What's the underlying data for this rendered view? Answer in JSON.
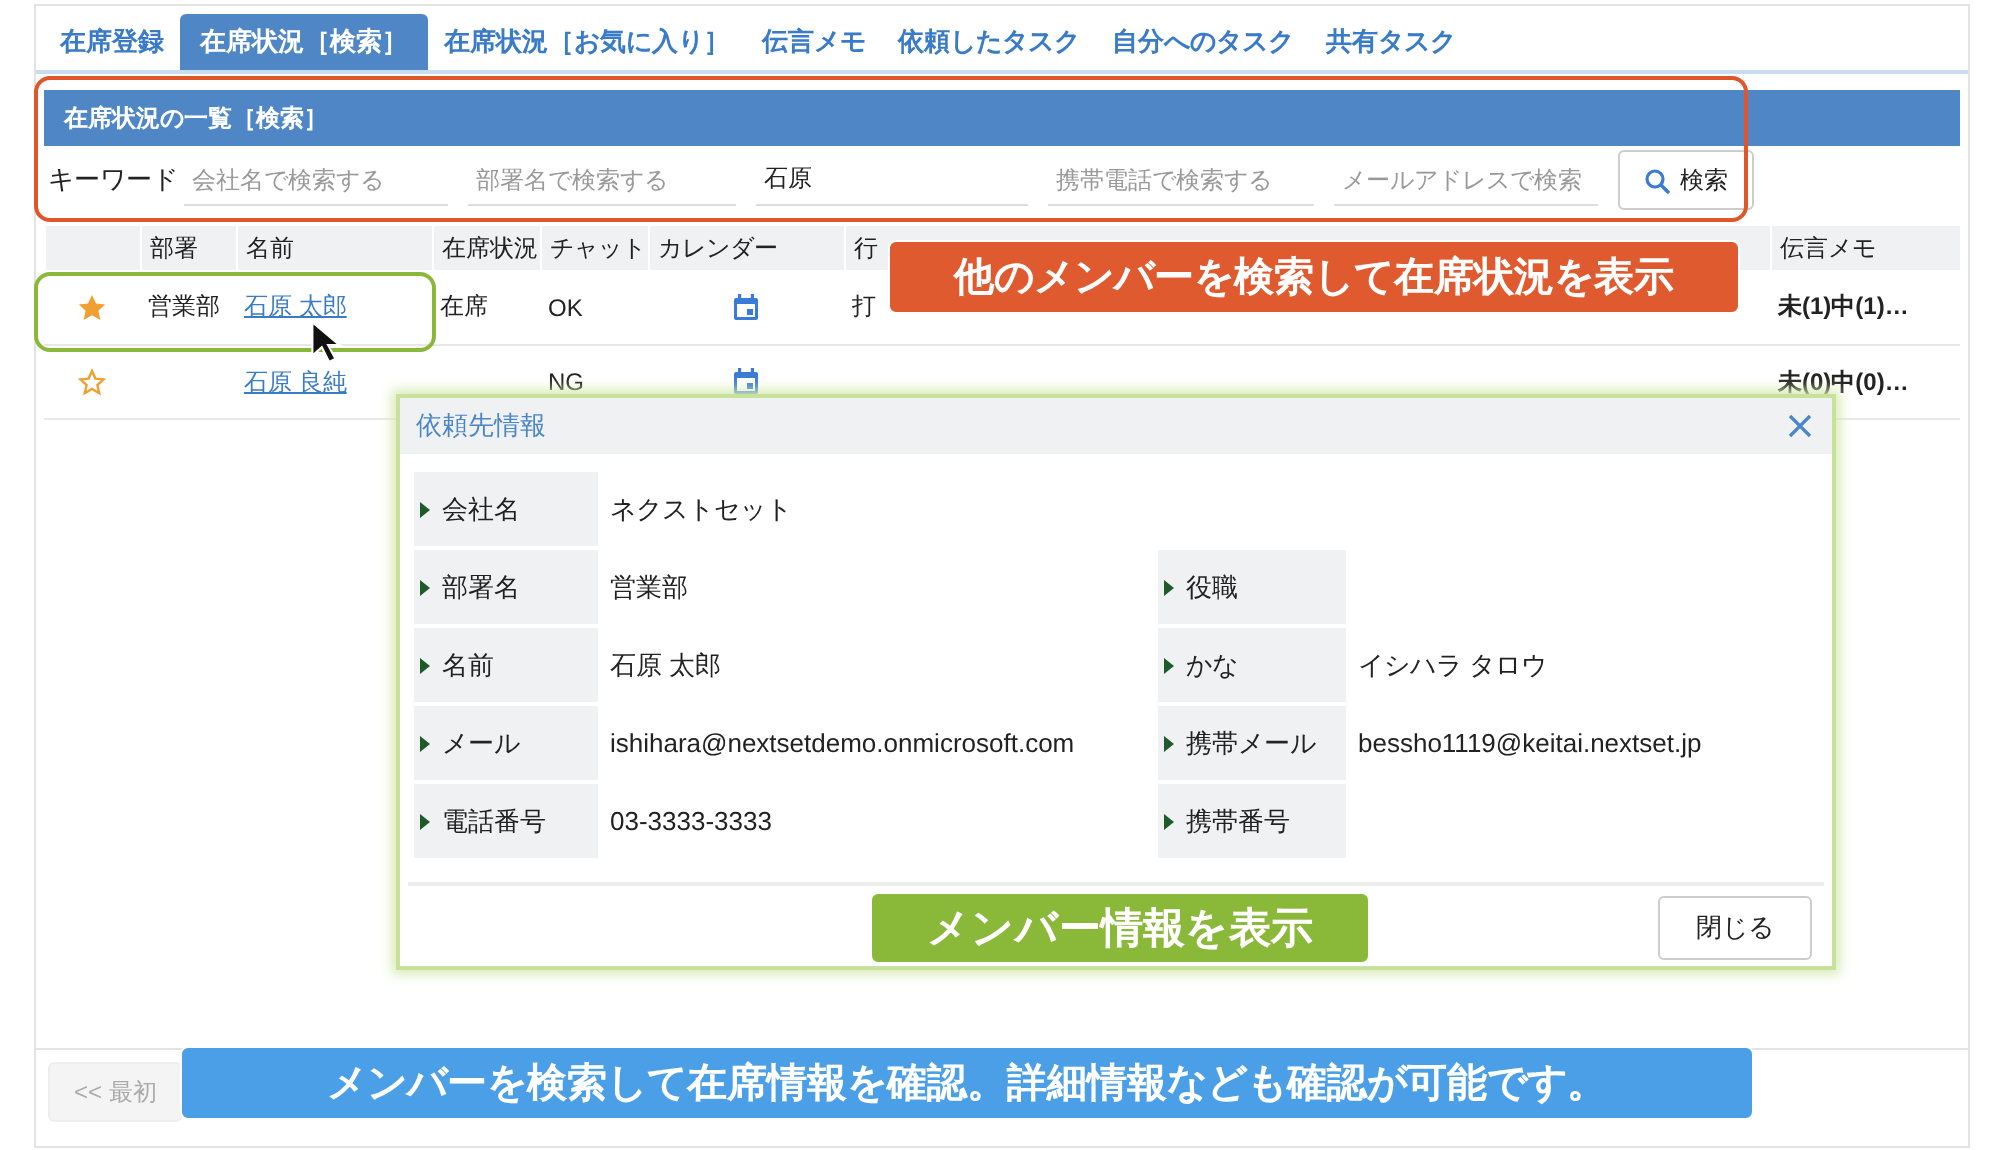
{
  "tabs": [
    {
      "label": "在席登録",
      "selected": false
    },
    {
      "label": "在席状況［検索］",
      "selected": true
    },
    {
      "label": "在席状況［お気に入り］",
      "selected": false
    },
    {
      "label": "伝言メモ",
      "selected": false
    },
    {
      "label": "依頼したタスク",
      "selected": false
    },
    {
      "label": "自分へのタスク",
      "selected": false
    },
    {
      "label": "共有タスク",
      "selected": false
    }
  ],
  "search_panel": {
    "title": "在席状況の一覧［検索］",
    "keyword_label": "キーワード",
    "fields": [
      {
        "placeholder": "会社名で検索する"
      },
      {
        "placeholder": "部署名で検索する"
      },
      {
        "value": "石原"
      },
      {
        "placeholder": "携帯電話で検索する"
      },
      {
        "placeholder": "メールアドレスで検索"
      }
    ],
    "search_button": "検索"
  },
  "table": {
    "columns": [
      "部署",
      "名前",
      "在席状況",
      "チャット",
      "カレンダー",
      "行",
      "伝言メモ"
    ],
    "rows": [
      {
        "favorite": true,
        "department": "営業部",
        "name": "石原 太郎",
        "status": "在席",
        "chat": "OK",
        "column_6": "打",
        "memo": "未(1)中(1)…"
      },
      {
        "favorite": false,
        "name": "石原 良純",
        "chat": "NG",
        "memo": "未(0)中(0)…"
      }
    ]
  },
  "dialog": {
    "title": "依頼先情報",
    "rows": [
      [
        {
          "label": "会社名",
          "value": "ネクストセット"
        }
      ],
      [
        {
          "label": "部署名",
          "value": "営業部"
        },
        {
          "label": "役職"
        }
      ],
      [
        {
          "label": "名前",
          "value": "石原 太郎"
        },
        {
          "label": "かな",
          "value": "イシハラ タロウ"
        }
      ],
      [
        {
          "label": "メール",
          "value": "ishihara@nextsetdemo.onmicrosoft.com"
        },
        {
          "label": "携帯メール",
          "value": "bessho1119@keitai.nextset.jp"
        }
      ],
      [
        {
          "label": "電話番号",
          "value": "03-3333-3333"
        },
        {
          "label": "携帯番号"
        }
      ]
    ],
    "close_button": "閉じる"
  },
  "pager": {
    "first_button": "<< 最初"
  },
  "callouts": [
    {
      "text": "他のメンバーを検索して在席状況を表示",
      "color": "#e05a30"
    },
    {
      "text": "メンバー情報を表示",
      "color": "#8ab838"
    },
    {
      "text": "メンバーを検索して在席情報を確認。詳細情報なども確認が可能です。",
      "color": "#4a9fe6"
    }
  ]
}
